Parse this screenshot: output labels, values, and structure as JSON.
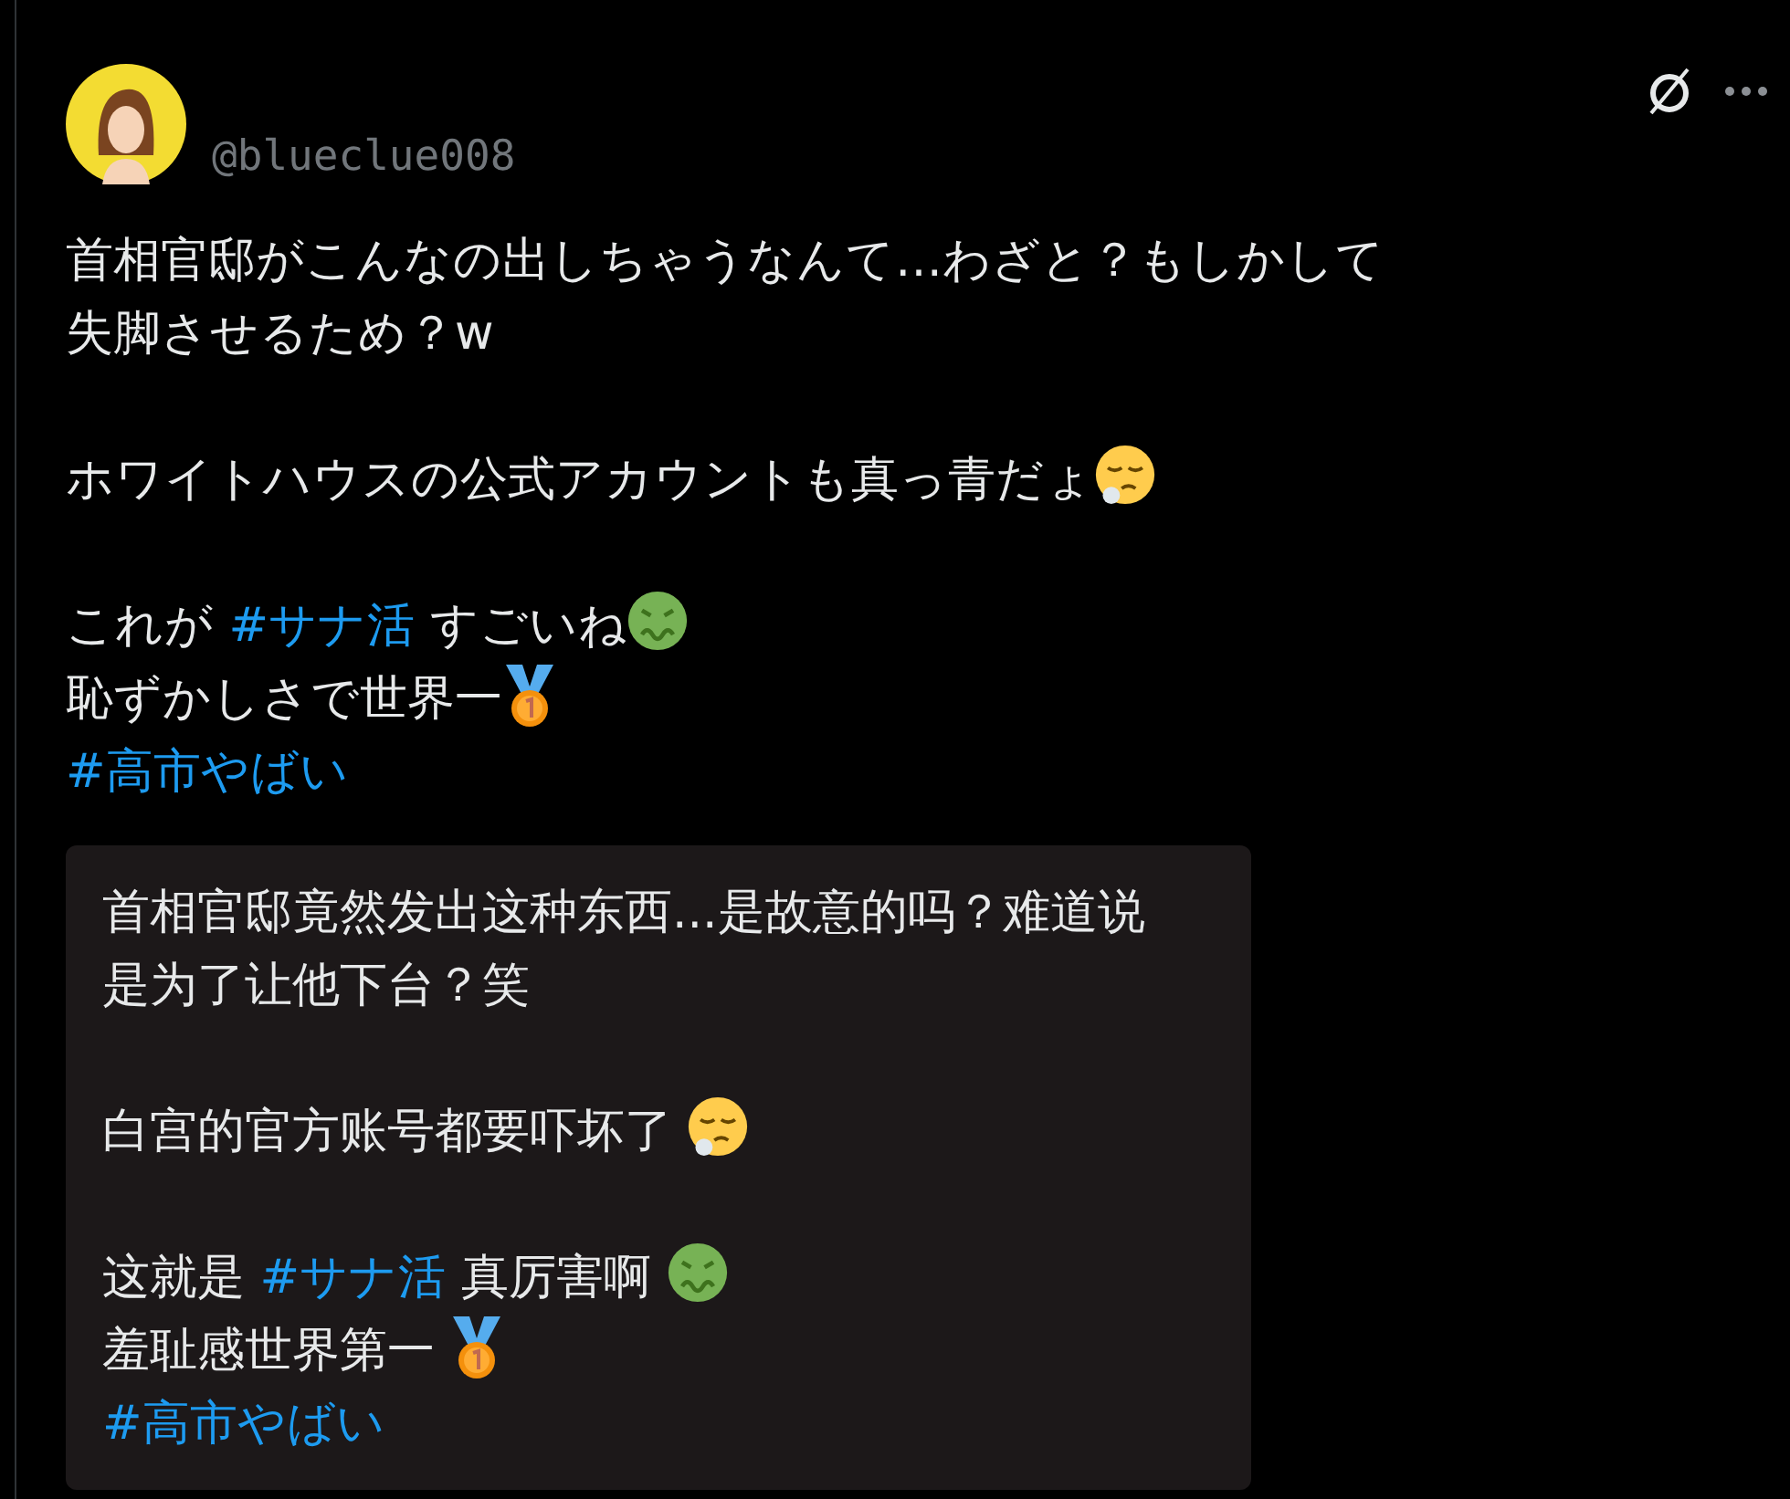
{
  "author": {
    "handle": "@blueclue008"
  },
  "post": {
    "paragraphs": [
      [
        [
          {
            "kind": "text",
            "text": "首相官邸がこんなの出しちゃうなんて…わざと？もしかして"
          }
        ],
        [
          {
            "kind": "text",
            "text": "失脚させるため？w"
          }
        ]
      ],
      [
        [
          {
            "kind": "text",
            "text": "ホワイトハウスの公式アカウントも真っ青だょ"
          },
          {
            "kind": "sigh"
          }
        ]
      ],
      [
        [
          {
            "kind": "text",
            "text": "これが "
          },
          {
            "kind": "tag",
            "text": "#サナ活"
          },
          {
            "kind": "text",
            "text": " すごいね"
          },
          {
            "kind": "sick"
          }
        ],
        [
          {
            "kind": "text",
            "text": "恥ずかしさで世界一"
          },
          {
            "kind": "medal"
          }
        ],
        [
          {
            "kind": "tag",
            "text": "#高市やばい"
          }
        ]
      ]
    ]
  },
  "translation": {
    "paragraphs": [
      [
        [
          {
            "kind": "text",
            "text": "首相官邸竟然发出这种东西...是故意的吗？难道说"
          }
        ],
        [
          {
            "kind": "text",
            "text": "是为了让他下台？笑"
          }
        ]
      ],
      [
        [
          {
            "kind": "text",
            "text": "白宫的官方账号都要吓坏了 "
          },
          {
            "kind": "sigh"
          }
        ]
      ],
      [
        [
          {
            "kind": "text",
            "text": "这就是 "
          },
          {
            "kind": "tag",
            "text": "#サナ活"
          },
          {
            "kind": "text",
            "text": " 真厉害啊 "
          },
          {
            "kind": "sick"
          }
        ],
        [
          {
            "kind": "text",
            "text": "羞耻感世界第一 "
          },
          {
            "kind": "medal"
          }
        ],
        [
          {
            "kind": "tag",
            "text": "#高市やばい"
          }
        ]
      ]
    ]
  }
}
